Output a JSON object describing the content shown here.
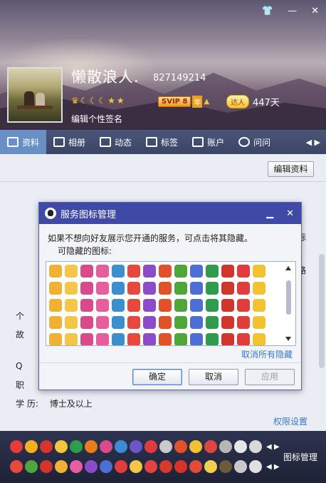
{
  "header": {
    "nickname": "懒散浪人.",
    "qq_number": "827149214",
    "vip_label": "SVIP 8",
    "vip_year": "年",
    "daren_label": "达人",
    "days": "447天",
    "signature": "编辑个性签名",
    "level_icons": [
      "crown-icon",
      "moon-icon",
      "moon-icon",
      "moon-icon",
      "star-icon",
      "star-icon"
    ]
  },
  "tabs": [
    {
      "label": "资料",
      "icon": "profile-icon"
    },
    {
      "label": "相册",
      "icon": "photo-icon"
    },
    {
      "label": "动态",
      "icon": "feed-icon"
    },
    {
      "label": "标签",
      "icon": "tag-icon"
    },
    {
      "label": "账户",
      "icon": "wallet-icon"
    },
    {
      "label": "问问",
      "icon": "question-icon"
    }
  ],
  "main": {
    "edit_button": "编辑资料",
    "partial_rows": [
      "个",
      "故",
      "Q",
      "职"
    ],
    "edu_label": "学 历:",
    "edu_value": "博士及以上",
    "side_fragments": [
      "际",
      "路"
    ],
    "permission_link": "权限设置"
  },
  "footer": {
    "manage_label": "图标管理"
  },
  "dialog": {
    "title": "服务图标管理",
    "message": "如果不想向好友展示您开通的服务，可点击将其隐藏。",
    "sub": "可隐藏的图标:",
    "cancel_all": "取消所有隐藏",
    "ok": "确定",
    "cancel": "取消",
    "apply": "应用"
  },
  "colors": {
    "title_bar": "#3f4aa5",
    "tab_bar": "#4a5579",
    "tab_active": "#6a8fc7",
    "link": "#3a77c7",
    "footer_bg": "#2e3450"
  }
}
